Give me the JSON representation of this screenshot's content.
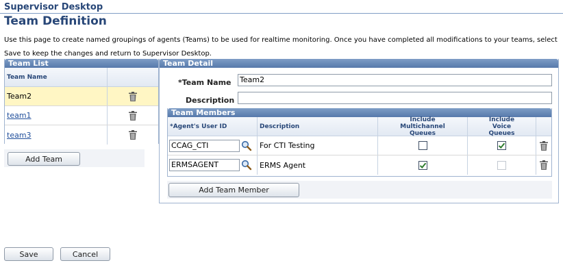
{
  "breadcrumb": "Supervisor Desktop",
  "page_title": "Team Definition",
  "instructions": "Use this page to create named groupings of agents (Teams) to be used for realtime monitoring. Once you have completed all modifications to your teams, select Save to keep the changes and return to Supervisor Desktop.",
  "team_list": {
    "header": "Team List",
    "column_header": "Team Name",
    "rows": [
      {
        "name": "Team2",
        "selected": true
      },
      {
        "name": "team1",
        "selected": false
      },
      {
        "name": "team3",
        "selected": false
      }
    ],
    "add_button": "Add Team"
  },
  "team_detail": {
    "header": "Team Detail",
    "team_name_label": "*Team Name",
    "team_name_value": "Team2",
    "description_label": "Description",
    "description_value": "",
    "members": {
      "header": "Team Members",
      "columns": {
        "user_id": "*Agent's User ID",
        "description": "Description",
        "multichannel": "Include Multichannel Queues",
        "voice": "Include Voice Queues"
      },
      "rows": [
        {
          "user_id": "CCAG_CTI",
          "description": "For CTI Testing",
          "multichannel": false,
          "voice": true,
          "voice_disabled": false
        },
        {
          "user_id": "ERMSAGENT",
          "description": "ERMS Agent",
          "multichannel": true,
          "voice": false,
          "voice_disabled": true
        }
      ],
      "add_button": "Add Team Member"
    }
  },
  "footer": {
    "save": "Save",
    "cancel": "Cancel"
  },
  "colors": {
    "accent": "#284778",
    "group_header": "#5679ab",
    "selected_row": "#fff6c4",
    "check_green": "#2f7d2f"
  },
  "icons": {
    "delete": "trash-icon",
    "lookup": "search-icon",
    "check": "checkmark-icon"
  }
}
